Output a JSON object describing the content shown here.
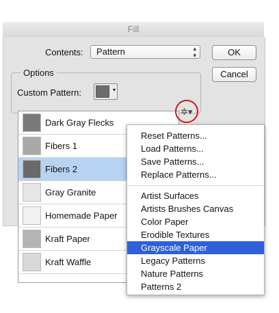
{
  "window": {
    "title": "Fill"
  },
  "contents": {
    "label": "Contents:",
    "value": "Pattern"
  },
  "buttons": {
    "ok": "OK",
    "cancel": "Cancel"
  },
  "options": {
    "label": "Options",
    "custom_pattern_label": "Custom Pattern:"
  },
  "patterns": [
    {
      "name": "Dark Gray Flecks",
      "thumb": "#7a7a7a",
      "selected": false
    },
    {
      "name": "Fibers 1",
      "thumb": "#a9a9a9",
      "selected": false
    },
    {
      "name": "Fibers 2",
      "thumb": "#696969",
      "selected": true
    },
    {
      "name": "Gray Granite",
      "thumb": "#e6e6e6",
      "selected": false
    },
    {
      "name": "Homemade Paper",
      "thumb": "#f2f2f2",
      "selected": false
    },
    {
      "name": "Kraft Paper",
      "thumb": "#b4b4b4",
      "selected": false
    },
    {
      "name": "Kraft Waffle",
      "thumb": "#d9d9d9",
      "selected": false
    }
  ],
  "menu": {
    "group1": [
      "Reset Patterns...",
      "Load Patterns...",
      "Save Patterns...",
      "Replace Patterns..."
    ],
    "group2": [
      "Artist Surfaces",
      "Artists Brushes Canvas",
      "Color Paper",
      "Erodible Textures",
      "Grayscale Paper",
      "Legacy Patterns",
      "Nature Patterns",
      "Patterns 2"
    ],
    "highlighted": "Grayscale Paper"
  },
  "colors": {
    "highlight": "#2f5fd9",
    "selection": "#b7d3f2",
    "callout": "#d0161c"
  },
  "icons": {
    "gear": "gear-icon"
  }
}
